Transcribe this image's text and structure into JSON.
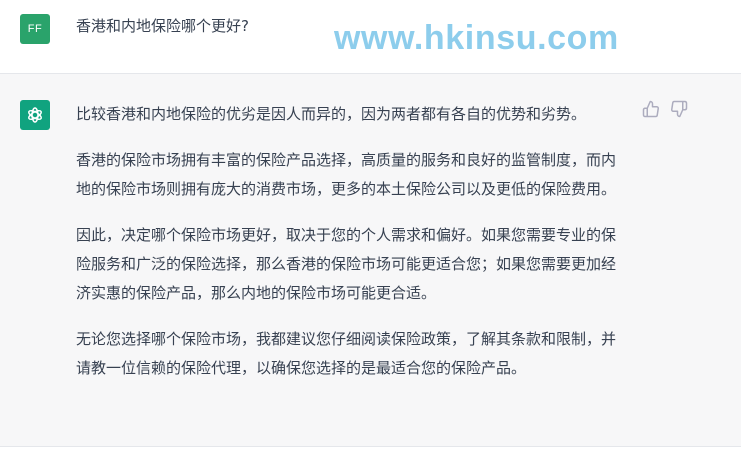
{
  "user_message": {
    "avatar_initials": "FF",
    "text": "香港和内地保险哪个更好?"
  },
  "watermark": "www.hkinsu.com",
  "assistant_message": {
    "paragraphs": [
      "比较香港和内地保险的优劣是因人而异的，因为两者都有各自的优势和劣势。",
      "香港的保险市场拥有丰富的保险产品选择，高质量的服务和良好的监管制度，而内地的保险市场则拥有庞大的消费市场，更多的本土保险公司以及更低的保险费用。",
      "因此，决定哪个保险市场更好，取决于您的个人需求和偏好。如果您需要专业的保险服务和广泛的保险选择，那么香港的保险市场可能更适合您；如果您需要更加经济实惠的保险产品，那么内地的保险市场可能更合适。",
      "无论您选择哪个保险市场，我都建议您仔细阅读保险政策，了解其条款和限制，并请教一位信赖的保险代理，以确保您选择的是最适合您的保险产品。"
    ]
  },
  "icons": {
    "assistant_avatar": "openai-logo-icon",
    "thumbs_up": "thumbs-up-icon",
    "thumbs_down": "thumbs-down-icon"
  },
  "colors": {
    "user_avatar_bg": "#2aa36b",
    "assistant_avatar_bg": "#10a37f",
    "assistant_row_bg": "#f7f7f8",
    "watermark": "#8dcdec",
    "text": "#374151"
  }
}
